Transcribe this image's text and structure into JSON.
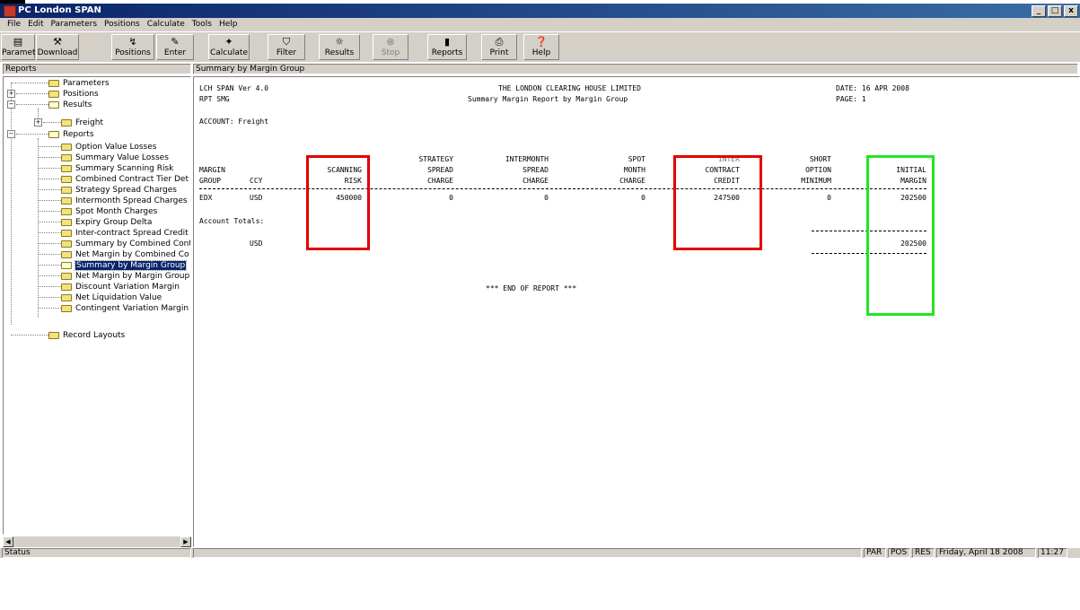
{
  "window": {
    "title": "PC London SPAN",
    "controls": [
      "_",
      "□",
      "x"
    ]
  },
  "menu": [
    "File",
    "Edit",
    "Parameters",
    "Positions",
    "Calculate",
    "Tools",
    "Help"
  ],
  "toolbar": [
    {
      "label": "Parameters",
      "icon": "parameters-icon",
      "glyph": "▤"
    },
    {
      "label": "Download",
      "icon": "download-icon",
      "glyph": "⚒"
    },
    {
      "label": "Positions",
      "icon": "positions-icon",
      "glyph": "↯"
    },
    {
      "label": "Enter",
      "icon": "enter-icon",
      "glyph": "✎"
    },
    {
      "label": "Calculate",
      "icon": "calculate-icon",
      "glyph": "✦"
    },
    {
      "label": "Filter",
      "icon": "filter-icon",
      "glyph": "⛉"
    },
    {
      "label": "Results",
      "icon": "results-icon",
      "glyph": "☼"
    },
    {
      "label": "Stop",
      "icon": "stop-icon",
      "glyph": "⊗"
    },
    {
      "label": "Reports",
      "icon": "reports-icon",
      "glyph": "▮"
    },
    {
      "label": "Print",
      "icon": "print-icon",
      "glyph": "⎙"
    },
    {
      "label": "Help",
      "icon": "help-icon",
      "glyph": "❓"
    }
  ],
  "panes": {
    "left_header": "Reports",
    "right_header": "Summary by Margin Group"
  },
  "tree": {
    "parameters": "Parameters",
    "positions": "Positions",
    "results": "Results",
    "freight": "Freight",
    "reports": "Reports",
    "report_items": [
      "Option Value Losses",
      "Summary Value Losses",
      "Summary Scanning Risk",
      "Combined Contract Tier Det",
      "Strategy Spread Charges",
      "Intermonth Spread Charges",
      "Spot Month Charges",
      "Expiry Group Delta",
      "Inter-contract Spread Credit",
      "Summary by Combined Cont",
      "Net Margin by Combined Co",
      "Summary by Margin Group",
      "Net Margin by Margin Group",
      "Discount Variation Margin",
      "Net Liquidation Value",
      "Contingent Variation Margin"
    ],
    "record_layouts": "Record Layouts",
    "selected": "Summary by Margin Group"
  },
  "report": {
    "version": "LCH SPAN Ver 4.0",
    "rpt": "RPT SMG",
    "org": "THE LONDON CLEARING HOUSE LIMITED",
    "subtitle": "Summary Margin Report by Margin Group",
    "date": "DATE: 16 APR 2008",
    "page": "PAGE: 1",
    "account": "ACCOUNT: Freight",
    "headers": {
      "margin_group": [
        "MARGIN",
        "GROUP"
      ],
      "ccy": [
        "CCY"
      ],
      "scanning_risk": [
        "SCANNING",
        "RISK"
      ],
      "strategy": [
        "STRATEGY",
        "SPREAD",
        "CHARGE"
      ],
      "intermonth": [
        "INTERMONTH",
        "SPREAD",
        "CHARGE"
      ],
      "spot_month": [
        "SPOT",
        "MONTH",
        "CHARGE"
      ],
      "inter_contract": [
        "INTER",
        "CONTRACT",
        "CREDIT"
      ],
      "short_option": [
        "SHORT",
        "OPTION",
        "MINIMUM"
      ],
      "initial_margin": [
        "INITIAL",
        "MARGIN"
      ]
    },
    "row": {
      "group": "EDX",
      "ccy": "USD",
      "scanning_risk": "450000",
      "strategy": "0",
      "intermonth": "0",
      "spot_month": "0",
      "inter_contract": "247500",
      "short_option": "0",
      "initial_margin": "202500"
    },
    "totals_label": "Account Totals:",
    "totals_ccy": "USD",
    "totals_initial_margin": "202500",
    "end": "*** END OF REPORT ***"
  },
  "status": {
    "label": "Status",
    "indicators": [
      "PAR",
      "POS",
      "RES"
    ],
    "date": "Friday, April 18 2008",
    "time": "11:27"
  },
  "colors": {
    "highlight_red": "#e30000",
    "highlight_green": "#22e522",
    "selection": "#0a246a"
  }
}
